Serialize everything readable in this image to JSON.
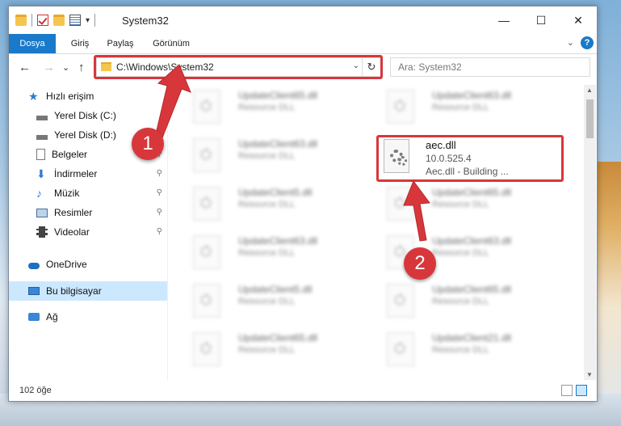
{
  "window": {
    "title": "System32",
    "controls": {
      "minimize": "—",
      "maximize": "☐",
      "close": "✕"
    }
  },
  "ribbon": {
    "tabs": [
      "Dosya",
      "Giriş",
      "Paylaş",
      "Görünüm"
    ],
    "help": "?"
  },
  "nav": {
    "back": "←",
    "forward": "→",
    "recent": "⌄",
    "up": "↑",
    "address": "C:\\Windows\\System32",
    "address_dropdown": "⌄",
    "refresh": "↻",
    "search_placeholder": "Ara: System32"
  },
  "sidebar": {
    "items": [
      {
        "label": "Hızlı erişim",
        "icon": "star-icon"
      },
      {
        "label": "Yerel Disk (C:)",
        "icon": "drive-icon"
      },
      {
        "label": "Yerel Disk (D:)",
        "icon": "drive-icon"
      },
      {
        "label": "Belgeler",
        "icon": "documents-icon"
      },
      {
        "label": "İndirmeler",
        "icon": "download-icon"
      },
      {
        "label": "Müzik",
        "icon": "music-icon"
      },
      {
        "label": "Resimler",
        "icon": "pictures-icon"
      },
      {
        "label": "Videolar",
        "icon": "video-icon"
      },
      {
        "label": "OneDrive",
        "icon": "cloud-icon"
      },
      {
        "label": "Bu bilgisayar",
        "icon": "computer-icon"
      },
      {
        "label": "Ağ",
        "icon": "network-icon"
      }
    ],
    "pin": "📌"
  },
  "files": {
    "left_column": [
      {
        "name": "UpdateClient65.dll",
        "desc": "Resource DLL"
      },
      {
        "name": "UpdateClient63.dll",
        "desc": "Resource DLL"
      },
      {
        "name": "UpdateClient5.dll",
        "desc": "Resource DLL"
      },
      {
        "name": "UpdateClient63.dll",
        "desc": "Resource DLL"
      },
      {
        "name": "UpdateClient5.dll",
        "desc": "Resource DLL"
      },
      {
        "name": "UpdateClient65.dll",
        "desc": "Resource DLL"
      }
    ],
    "right_column": [
      {
        "name": "UpdateClient63.dll",
        "desc": "Resource DLL"
      },
      {
        "name": "UpdateClient65.dll",
        "desc": "Resource DLL"
      },
      {
        "name": "UpdateClient63.dll",
        "desc": "Resource DLL"
      },
      {
        "name": "UpdateClient65.dll",
        "desc": "Resource DLL"
      },
      {
        "name": "UpdateClient21.dll",
        "desc": "Resource DLL"
      }
    ],
    "highlighted": {
      "name": "aec.dll",
      "version": "10.0.525.4",
      "description": "Aec.dll - Building ..."
    }
  },
  "status": {
    "item_count": "102 öğe"
  },
  "annotations": {
    "step1": "1",
    "step2": "2",
    "color": "#d7373b"
  }
}
